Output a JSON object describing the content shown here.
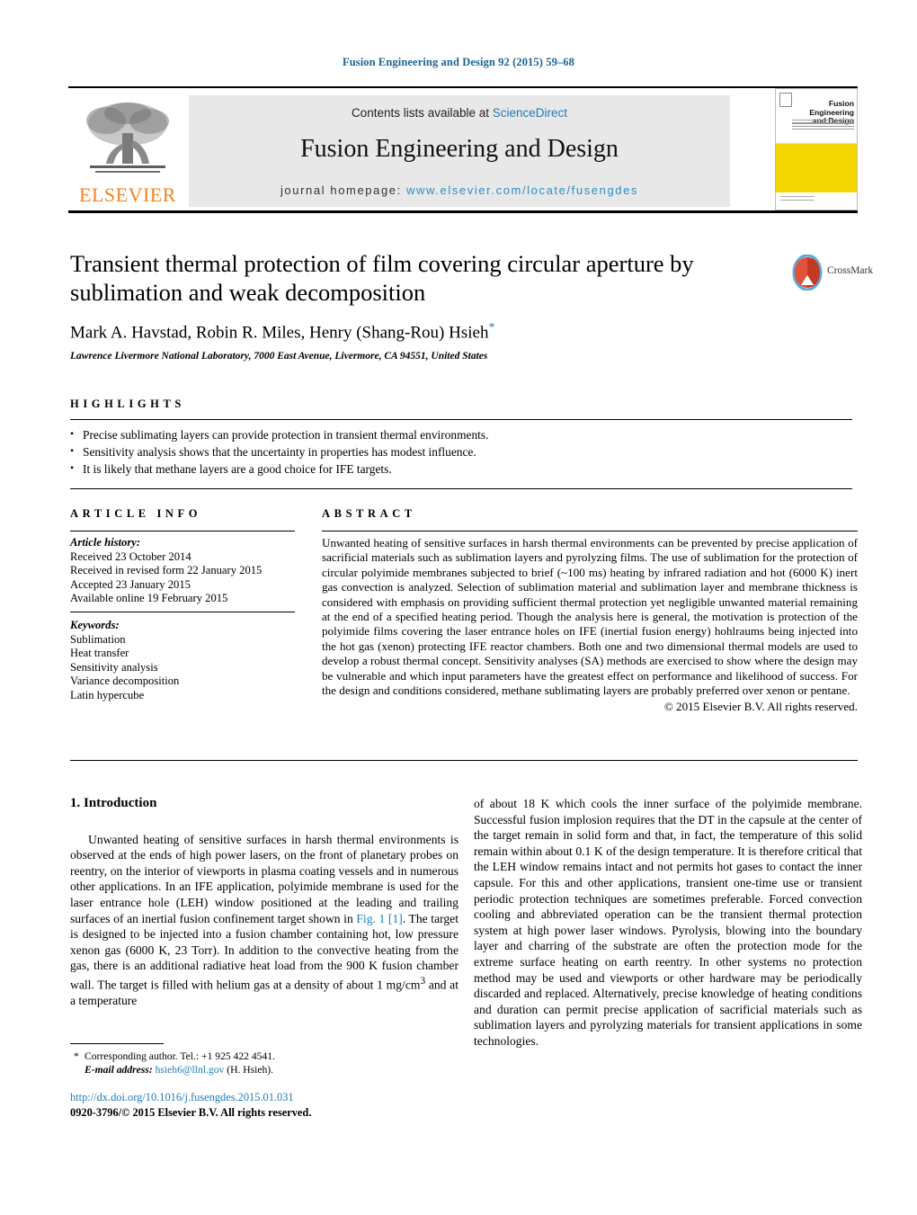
{
  "running_head": "Fusion Engineering and Design 92 (2015) 59–68",
  "masthead": {
    "contents_prefix": "Contents lists available at ",
    "sciencedirect": "ScienceDirect",
    "journal_title": "Fusion Engineering and Design",
    "homepage_prefix": "journal homepage: ",
    "homepage_url": "www.elsevier.com/locate/fusengdes",
    "publisher_logo_word": "ELSEVIER",
    "cover_title_line1": "Fusion Engineering",
    "cover_title_line2": "and Design",
    "accent_orange": "#f58220",
    "accent_blue": "#1f7bb6",
    "cover_yellow": "#f5d803"
  },
  "article": {
    "title": "Transient thermal protection of film covering circular aperture by sublimation and weak decomposition",
    "authors": "Mark A. Havstad, Robin R. Miles, Henry (Shang-Rou) Hsieh",
    "corresponding_marker": "*",
    "affiliation": "Lawrence Livermore National Laboratory, 7000 East Avenue, Livermore, CA 94551, United States",
    "crossmark_label": "CrossMark"
  },
  "highlights": {
    "heading": "HIGHLIGHTS",
    "items": [
      "Precise sublimating layers can provide protection in transient thermal environments.",
      "Sensitivity analysis shows that the uncertainty in properties has modest influence.",
      "It is likely that methane layers are a good choice for IFE targets."
    ]
  },
  "article_info": {
    "heading": "ARTICLE INFO",
    "history_label": "Article history:",
    "history": [
      "Received 23 October 2014",
      "Received in revised form 22 January 2015",
      "Accepted 23 January 2015",
      "Available online 19 February 2015"
    ],
    "keywords_label": "Keywords:",
    "keywords": [
      "Sublimation",
      "Heat transfer",
      "Sensitivity analysis",
      "Variance decomposition",
      "Latin hypercube"
    ]
  },
  "abstract": {
    "heading": "ABSTRACT",
    "text": "Unwanted heating of sensitive surfaces in harsh thermal environments can be prevented by precise application of sacrificial materials such as sublimation layers and pyrolyzing films. The use of sublimation for the protection of circular polyimide membranes subjected to brief (~100 ms) heating by infrared radiation and hot (6000 K) inert gas convection is analyzed. Selection of sublimation material and sublimation layer and membrane thickness is considered with emphasis on providing sufficient thermal protection yet negligible unwanted material remaining at the end of a specified heating period. Though the analysis here is general, the motivation is protection of the polyimide films covering the laser entrance holes on IFE (inertial fusion energy) hohlraums being injected into the hot gas (xenon) protecting IFE reactor chambers. Both one and two dimensional thermal models are used to develop a robust thermal concept. Sensitivity analyses (SA) methods are exercised to show where the design may be vulnerable and which input parameters have the greatest effect on performance and likelihood of success. For the design and conditions considered, methane sublimating layers are probably preferred over xenon or pentane.",
    "copyright": "© 2015 Elsevier B.V. All rights reserved."
  },
  "body": {
    "section_number_title": "1.  Introduction",
    "left_paragraph_a": "Unwanted heating of sensitive surfaces in harsh thermal environments is observed at the ends of high power lasers, on the front of planetary probes on reentry, on the interior of viewports in plasma coating vessels and in numerous other applications. In an IFE application, polyimide membrane is used for the laser entrance hole (LEH) window positioned at the leading and trailing surfaces of an inertial fusion confinement target shown in ",
    "left_figure_ref": "Fig. 1 [1]",
    "left_paragraph_b": ". The target is designed to be injected into a fusion chamber containing hot, low pressure xenon gas (6000 K, 23 Torr). In addition to the convective heating from the gas, there is an additional radiative heat load from the 900 K fusion chamber wall. The target is filled with helium gas at a density of about 1 mg/cm",
    "left_superscript": "3",
    "left_paragraph_c": " and at a temperature",
    "right_paragraph": "of about 18 K which cools the inner surface of the polyimide membrane. Successful fusion implosion requires that the DT in the capsule at the center of the target remain in solid form and that, in fact, the temperature of this solid remain within about 0.1 K of the design temperature. It is therefore critical that the LEH window remains intact and not permits hot gases to contact the inner capsule. For this and other applications, transient one-time use or transient periodic protection techniques are sometimes preferable. Forced convection cooling and abbreviated operation can be the transient thermal protection system at high power laser windows. Pyrolysis, blowing into the boundary layer and charring of the substrate are often the protection mode for the extreme surface heating on earth reentry. In other systems no protection method may be used and viewports or other hardware may be periodically discarded and replaced. Alternatively, precise knowledge of heating conditions and duration can permit precise application of sacrificial materials such as sublimation layers and pyrolyzing materials for transient applications in some technologies."
  },
  "footnote": {
    "star": "*",
    "corresponding": "Corresponding author. Tel.: +1 925 422 4541.",
    "email_label": "E-mail address:",
    "email": "hsieh6@llnl.gov",
    "email_owner": "(H. Hsieh)."
  },
  "footer": {
    "doi_url": "http://dx.doi.org/10.1016/j.fusengdes.2015.01.031",
    "issn_line": "0920-3796/© 2015 Elsevier B.V. All rights reserved."
  }
}
